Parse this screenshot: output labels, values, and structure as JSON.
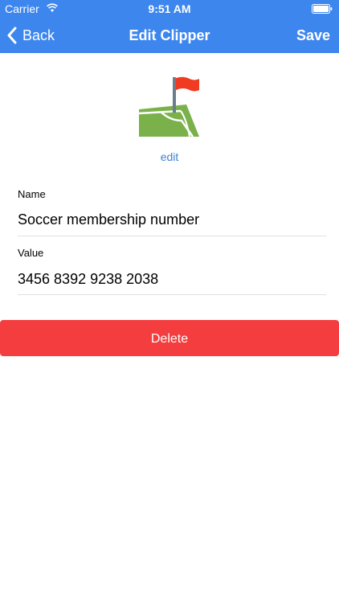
{
  "status_bar": {
    "carrier": "Carrier",
    "time": "9:51 AM"
  },
  "nav": {
    "back_label": "Back",
    "title": "Edit Clipper",
    "save_label": "Save"
  },
  "clipper": {
    "icon": "soccer-corner-flag-icon",
    "edit_label": "edit"
  },
  "form": {
    "name": {
      "label": "Name",
      "value": "Soccer membership number"
    },
    "value": {
      "label": "Value",
      "value": "3456 8392 9238 2038"
    }
  },
  "actions": {
    "delete_label": "Delete"
  },
  "colors": {
    "nav_background": "#3c86ee",
    "link": "#3c7fd9",
    "delete_background": "#f43d3f"
  }
}
